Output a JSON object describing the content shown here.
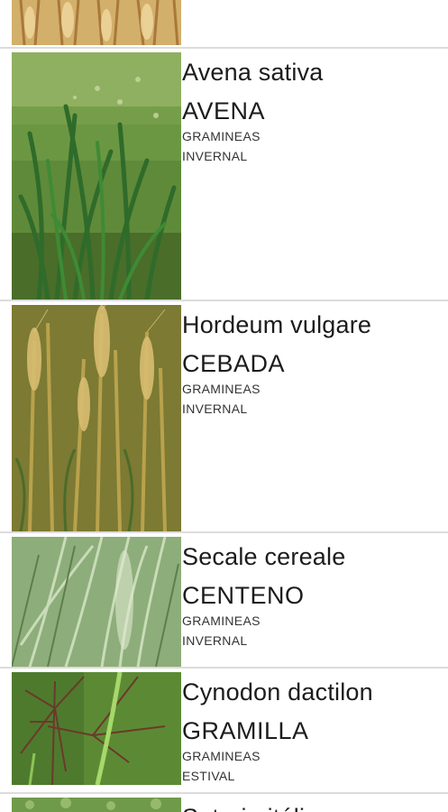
{
  "items": [
    {
      "scientific_name": "",
      "common_name": "",
      "family": "",
      "season": "",
      "image": "wheat-photo"
    },
    {
      "scientific_name": "Avena sativa",
      "common_name": "AVENA",
      "family": "GRAMINEAS",
      "season": "INVERNAL",
      "image": "oat-photo"
    },
    {
      "scientific_name": "Hordeum vulgare",
      "common_name": "CEBADA",
      "family": "GRAMINEAS",
      "season": "INVERNAL",
      "image": "barley-photo"
    },
    {
      "scientific_name": "Secale cereale",
      "common_name": "CENTENO",
      "family": "GRAMINEAS",
      "season": "INVERNAL",
      "image": "rye-photo"
    },
    {
      "scientific_name": "Cynodon dactilon",
      "common_name": "GRAMILLA",
      "family": "GRAMINEAS",
      "season": "ESTIVAL",
      "image": "bermuda-grass-photo"
    },
    {
      "scientific_name": "Setaria itálica",
      "common_name": "",
      "family": "",
      "season": "",
      "image": "foxtail-millet-photo"
    }
  ]
}
